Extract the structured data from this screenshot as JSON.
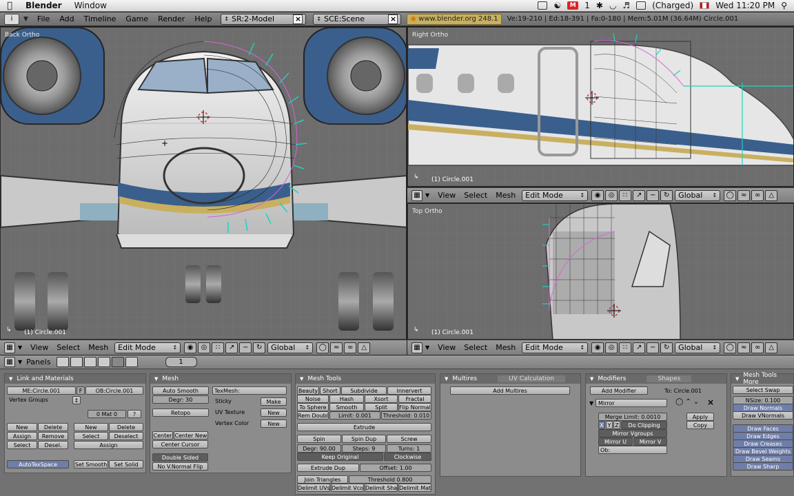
{
  "menubar": {
    "app": "Blender",
    "items": [
      "Window"
    ],
    "gmail_count": "1",
    "battery": "(Charged)",
    "clock": "Wed 11:20 PM"
  },
  "info": {
    "menus": [
      "File",
      "Add",
      "Timeline",
      "Game",
      "Render",
      "Help"
    ],
    "screen": "SR:2-Model",
    "scene": "SCE:Scene",
    "url": "www.blender.org 248.1",
    "stats": "Ve:19-210 | Ed:18-391 | Fa:0-180 | Mem:5.01M (36.64M) Circle.001"
  },
  "viewports": {
    "back": {
      "title": "Back Ortho",
      "object": "(1) Circle.001"
    },
    "right": {
      "title": "Right Ortho",
      "object": "(1) Circle.001"
    },
    "top": {
      "title": "Top Ortho",
      "object": "(1) Circle.001"
    },
    "header": {
      "view": "View",
      "select": "Select",
      "mesh": "Mesh",
      "mode": "Edit Mode",
      "orient": "Global"
    }
  },
  "buttons": {
    "header_label": "Panels",
    "page": "1",
    "link": {
      "title": "Link and Materials",
      "me": "ME:Circle.001",
      "f": "F",
      "ob": "OB:Circle.001",
      "vgroups": "Vertex Groups",
      "mat": "0 Mat 0",
      "q": "?",
      "b_new": "New",
      "b_delete": "Delete",
      "b_assign": "Assign",
      "b_remove": "Remove",
      "b_select": "Select",
      "b_desel": "Desel.",
      "m_new": "New",
      "m_delete": "Delete",
      "m_select": "Select",
      "m_deselect": "Deselect",
      "m_assign": "Assign",
      "autotex": "AutoTexSpace",
      "setsmooth": "Set Smooth",
      "setsolid": "Set Solid"
    },
    "mesh": {
      "title": "Mesh",
      "autosmooth": "Auto Smooth",
      "degr": "Degr: 30",
      "retopo": "Retopo",
      "center": "Center",
      "centernew": "Center New",
      "centercursor": "Center Cursor",
      "doublesided": "Double Sided",
      "nonormal": "No V.Normal Flip",
      "texmesh": "TexMesh:",
      "sticky": "Sticky",
      "make": "Make",
      "uvtex": "UV Texture",
      "new1": "New",
      "vcol": "Vertex Color",
      "new2": "New"
    },
    "tools": {
      "title": "Mesh Tools",
      "beauty": "Beauty",
      "short": "Short",
      "subdivide": "Subdivide",
      "innervert": "Innervert",
      "noise": "Noise",
      "hash": "Hash",
      "xsort": "Xsort",
      "fractal": "Fractal",
      "tosphere": "To Sphere",
      "smooth": "Smooth",
      "split": "Split",
      "flipnormals": "Flip Normals",
      "remdouble": "Rem Double",
      "limit": "Limit: 0.001",
      "threshold": "Threshold: 0.010",
      "extrude": "Extrude",
      "spin": "Spin",
      "spindup": "Spin Dup",
      "screw": "Screw",
      "degr90": "Degr: 90.00",
      "steps": "Steps: 9",
      "turns": "Turns: 1",
      "keeporiginal": "Keep Original",
      "clockwise": "Clockwise",
      "extrudedup": "Extrude Dup",
      "offset": "Offset: 1.00",
      "jointri": "Join Triangles",
      "thresh08": "Threshold 0.800",
      "delimituv": "Delimit UVs",
      "delimitvcol": "Delimit Vcol",
      "delimitshar": "Delimit Shar",
      "delimitmat": "Delimit Mat"
    },
    "multires": {
      "title": "Multires",
      "tab2": "UV Calculation",
      "add": "Add Multires"
    },
    "modifiers": {
      "title": "Modifiers",
      "tab2": "Shapes",
      "add": "Add Modifier",
      "to": "To: Circle.001",
      "mirror": "Mirror",
      "merge": "Merge Limit: 0.0010",
      "x": "X",
      "y": "Y",
      "z": "Z",
      "clipping": "Do Clipping",
      "vgroups": "Mirror Vgroups",
      "mu": "Mirror U",
      "mv": "Mirror V",
      "ob": "Ob:",
      "apply": "Apply",
      "copy": "Copy"
    },
    "more": {
      "title": "Mesh Tools More",
      "swap": "Select Swap",
      "nsize": "NSize: 0.100",
      "drawnormals": "Draw Normals",
      "drawvnormals": "Draw VNormals",
      "drawfaces": "Draw Faces",
      "drawedges": "Draw Edges",
      "drawcreases": "Draw Creases",
      "drawbevel": "Draw Bevel Weights",
      "drawseams": "Draw Seams",
      "drawsharp": "Draw Sharp"
    }
  }
}
